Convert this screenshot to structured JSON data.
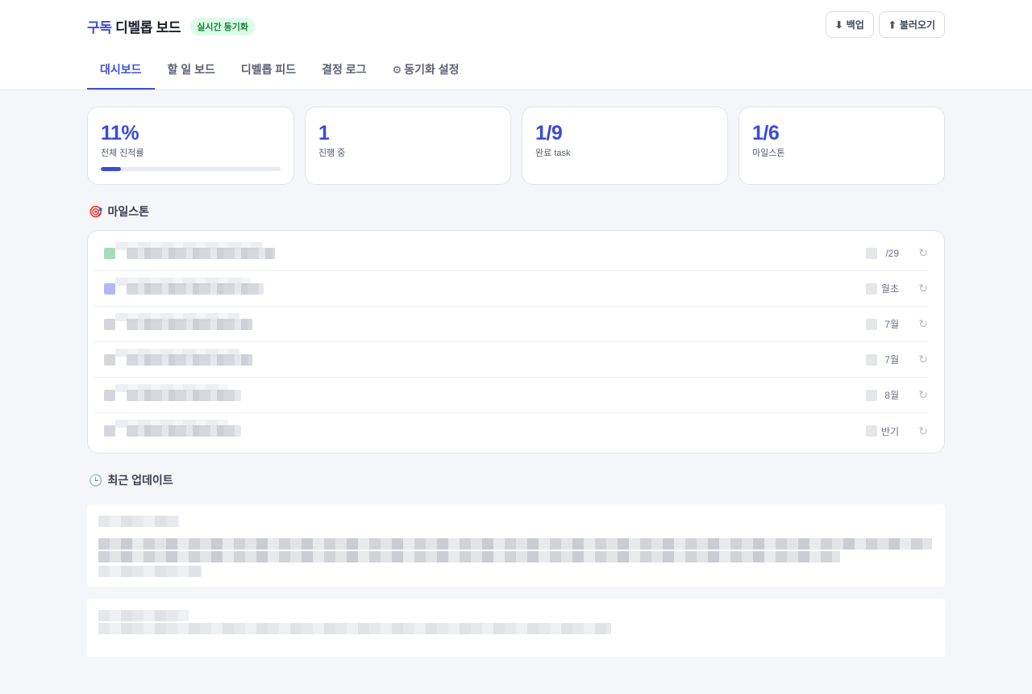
{
  "header": {
    "brand_accent": "구독",
    "brand_rest": "디벨롭 보드",
    "live_badge": "실시간 동기화",
    "backup_label": "백업",
    "import_label": "불러오기"
  },
  "tabs": [
    {
      "label": "대시보드",
      "active": true
    },
    {
      "label": "할 일 보드",
      "active": false
    },
    {
      "label": "디벨롭 피드",
      "active": false
    },
    {
      "label": "결정 로그",
      "active": false
    },
    {
      "label": "동기화 설정",
      "active": false
    }
  ],
  "stats": [
    {
      "value": "11%",
      "label": "전체 진척률",
      "progress": 0.11
    },
    {
      "value": "1",
      "label": "진행 중"
    },
    {
      "value": "1/9",
      "label": "완료 task"
    },
    {
      "value": "1/6",
      "label": "마일스톤"
    }
  ],
  "milestones": {
    "title": "마일스톤",
    "rows": [
      {
        "date": "/29",
        "swatch": "#a6dcb7",
        "blur_width": 196
      },
      {
        "date": "월초",
        "swatch": "#b3b8f5",
        "blur_width": 182
      },
      {
        "date": "7월",
        "swatch": "#d5d6dc",
        "blur_width": 168
      },
      {
        "date": "7월",
        "swatch": "#d5d6dc",
        "blur_width": 168
      },
      {
        "date": "8월",
        "swatch": "#d5d6dc",
        "blur_width": 154
      },
      {
        "date": "반기",
        "swatch": "#d5d6dc",
        "blur_width": 154
      }
    ]
  },
  "updates": {
    "title": "최근 업데이트"
  },
  "colors": {
    "accent": "#3d4fd6",
    "live_green": "#16803c"
  }
}
